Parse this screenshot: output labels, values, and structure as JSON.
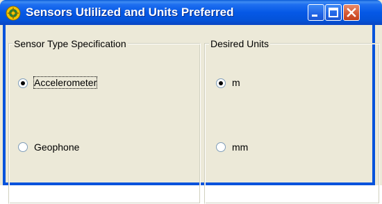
{
  "window": {
    "title": "Sensors Utlilized and Units Preferred",
    "controls": {
      "minimize": "minimize-icon",
      "maximize": "maximize-icon",
      "close": "close-icon"
    }
  },
  "colors": {
    "titlebar": "#0558e6",
    "frame": "#0553dc",
    "client": "#ece9d8",
    "close_button": "#d65a35"
  },
  "sensor_group": {
    "legend": "Sensor Type Specification",
    "options": [
      {
        "label": "Accelerometer",
        "selected": true
      },
      {
        "label": "Geophone",
        "selected": false
      }
    ]
  },
  "units_group": {
    "legend": "Desired Units",
    "options": [
      {
        "label": "m",
        "selected": true
      },
      {
        "label": "mm",
        "selected": false
      }
    ]
  }
}
